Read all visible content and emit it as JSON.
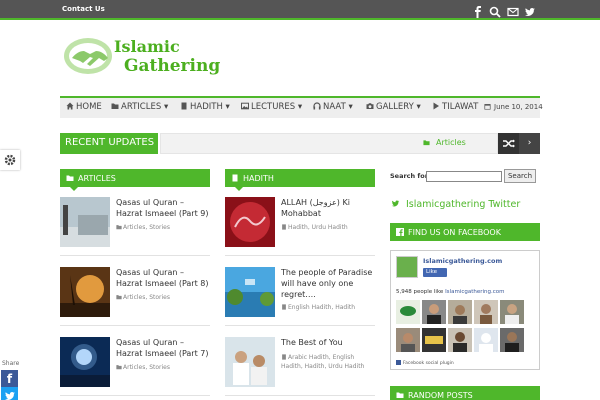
{
  "topbar": {
    "contact_label": "Contact Us",
    "icons": [
      "facebook-icon",
      "search-icon",
      "mail-icon",
      "twitter-icon"
    ]
  },
  "logo": {
    "line1": "Islamic",
    "line2": "Gathering"
  },
  "nav": {
    "items": [
      {
        "label": "HOME",
        "icon": "home-icon"
      },
      {
        "label": "ARTICLES",
        "icon": "folder-icon"
      },
      {
        "label": "HADITH",
        "icon": "book-icon"
      },
      {
        "label": "LECTURES",
        "icon": "image-icon"
      },
      {
        "label": "NAAT",
        "icon": "headphones-icon"
      },
      {
        "label": "GALLERY",
        "icon": "camera-icon"
      },
      {
        "label": "TILAWAT",
        "icon": "play-icon"
      }
    ],
    "date": "June 10, 2014"
  },
  "recent_updates": {
    "label": "RECENT UPDATES",
    "ticker": "Articles",
    "next": "›"
  },
  "articles": {
    "header": "ARTICLES",
    "posts": [
      {
        "title": "Qasas ul Quran – Hazrat Ismaeel (Part 9)",
        "meta": "Articles, Stories"
      },
      {
        "title": "Qasas ul Quran – Hazrat Ismaeel (Part 8)",
        "meta": "Articles, Stories"
      },
      {
        "title": "Qasas ul Quran – Hazrat Ismaeel (Part 7)",
        "meta": "Articles, Stories"
      }
    ]
  },
  "hadith": {
    "header": "HADITH",
    "posts": [
      {
        "title": "ALLAH (عزوجل) Ki Mohabbat",
        "meta": "Hadith, Urdu Hadith"
      },
      {
        "title": "The people of Paradise will have only one regret….",
        "meta": "English Hadith, Hadith"
      },
      {
        "title": "The Best of You",
        "meta": "Arabic Hadith, English Hadith, Hadith, Urdu Hadith"
      }
    ]
  },
  "sidebar": {
    "search_label": "Search for:",
    "search_value": "",
    "search_button": "Search",
    "twitter_link": "Islamicgathering Twitter",
    "facebook_header": "FIND US ON FACEBOOK",
    "fb_site": "Islamicgathering.com",
    "fb_like": "Like",
    "fb_count_prefix": "5,948 people like ",
    "fb_count_site": "Islamicgathering.com",
    "fb_plugin": "Facebook social plugin",
    "random_header": "RANDOM POSTS"
  },
  "share": {
    "label": "Share",
    "fb": "f"
  },
  "colors": {
    "accent": "#4fb72b",
    "topbar": "#555555",
    "facebook": "#3b5998"
  }
}
